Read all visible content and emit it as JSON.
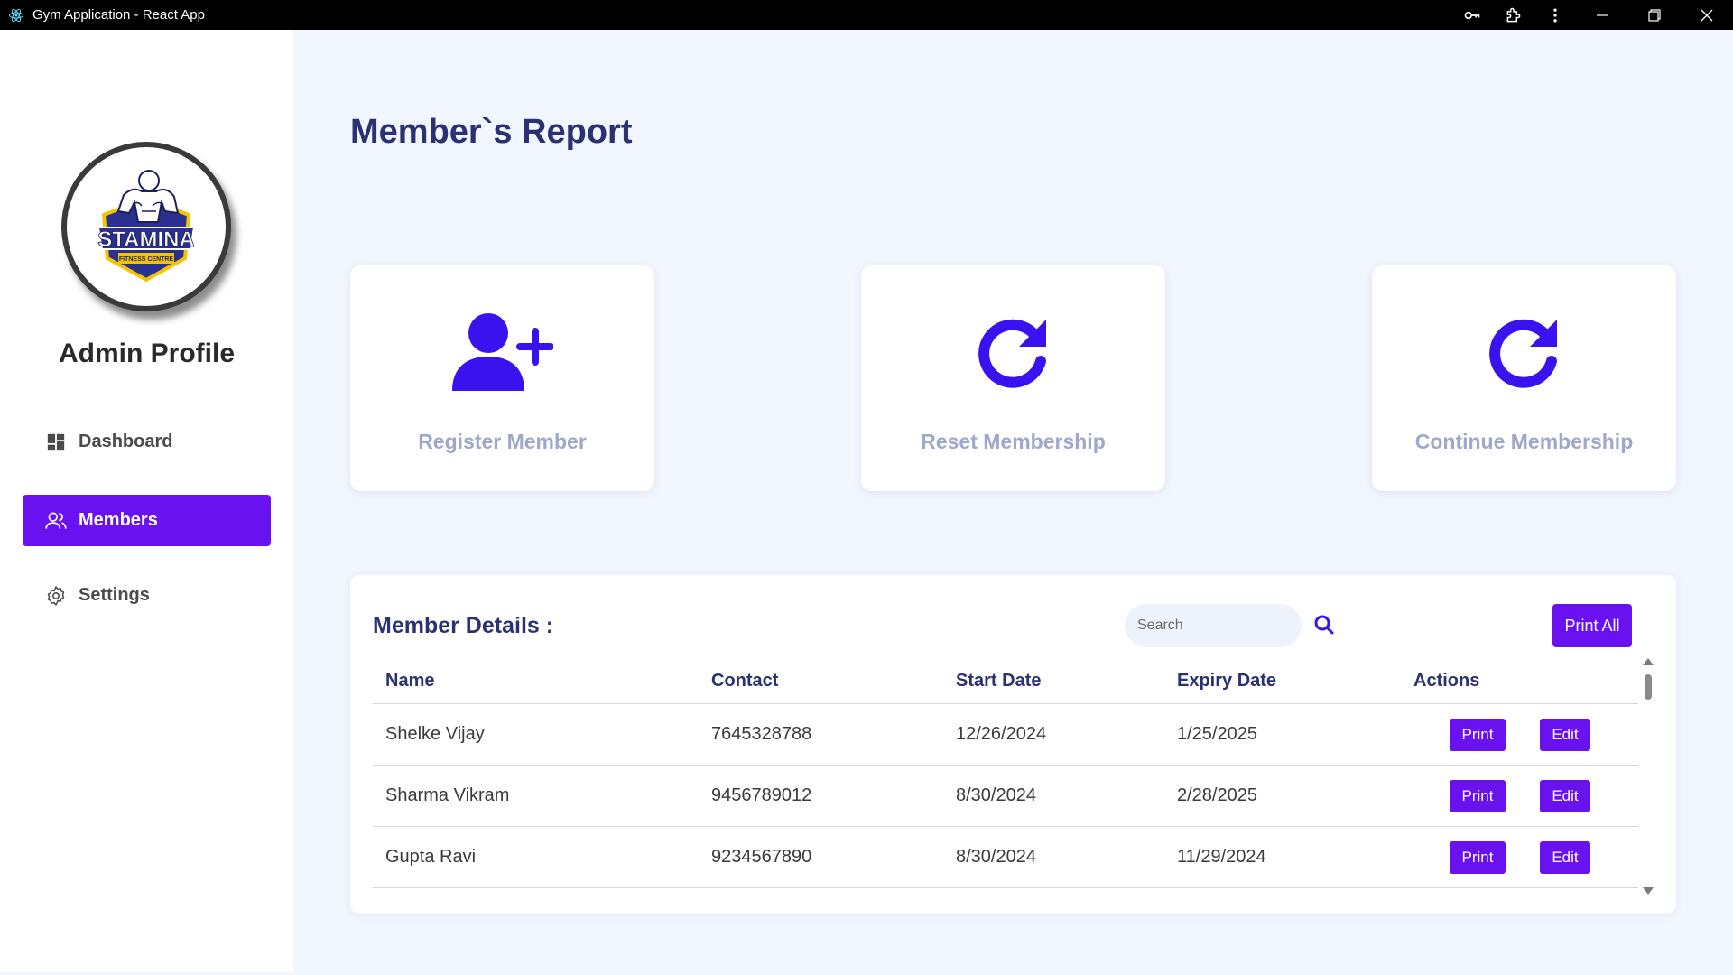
{
  "window": {
    "title": "Gym Application - React App",
    "app_icon": "react-icon",
    "controls": [
      "key-icon",
      "extension-icon",
      "more-vert-icon",
      "minimize-icon",
      "restore-icon",
      "close-icon"
    ]
  },
  "sidebar": {
    "logo": {
      "brand": "STAMINA",
      "tagline": "FITNESS CENTRE"
    },
    "profile_title": "Admin Profile",
    "items": [
      {
        "label": "Dashboard",
        "icon": "dashboard-icon",
        "active": false
      },
      {
        "label": "Members",
        "icon": "users-icon",
        "active": true
      },
      {
        "label": "Settings",
        "icon": "gear-icon",
        "active": false
      }
    ]
  },
  "main": {
    "page_title": "Member`s Report",
    "cards": [
      {
        "label": "Register Member",
        "icon": "user-plus-icon"
      },
      {
        "label": "Reset Membership",
        "icon": "redo-icon"
      },
      {
        "label": "Continue Membership",
        "icon": "redo-icon"
      }
    ],
    "member_details": {
      "title": "Member Details :",
      "search_placeholder": "Search",
      "print_all_label": "Print All",
      "columns": [
        "Name",
        "Contact",
        "Start Date",
        "Expiry Date",
        "Actions"
      ],
      "rows": [
        {
          "name": "Shelke Vijay",
          "contact": "7645328788",
          "start": "12/26/2024",
          "expiry": "1/25/2025"
        },
        {
          "name": "Sharma Vikram",
          "contact": "9456789012",
          "start": "8/30/2024",
          "expiry": "2/28/2025"
        },
        {
          "name": "Gupta Ravi",
          "contact": "9234567890",
          "start": "8/30/2024",
          "expiry": "11/29/2024"
        }
      ],
      "print_label": "Print",
      "edit_label": "Edit"
    }
  },
  "colors": {
    "accent": "#6a11f0",
    "icon_blue": "#3a12f0",
    "heading": "#2b3172",
    "card_label": "#9fa8cc",
    "background": "#f2f6fe"
  }
}
